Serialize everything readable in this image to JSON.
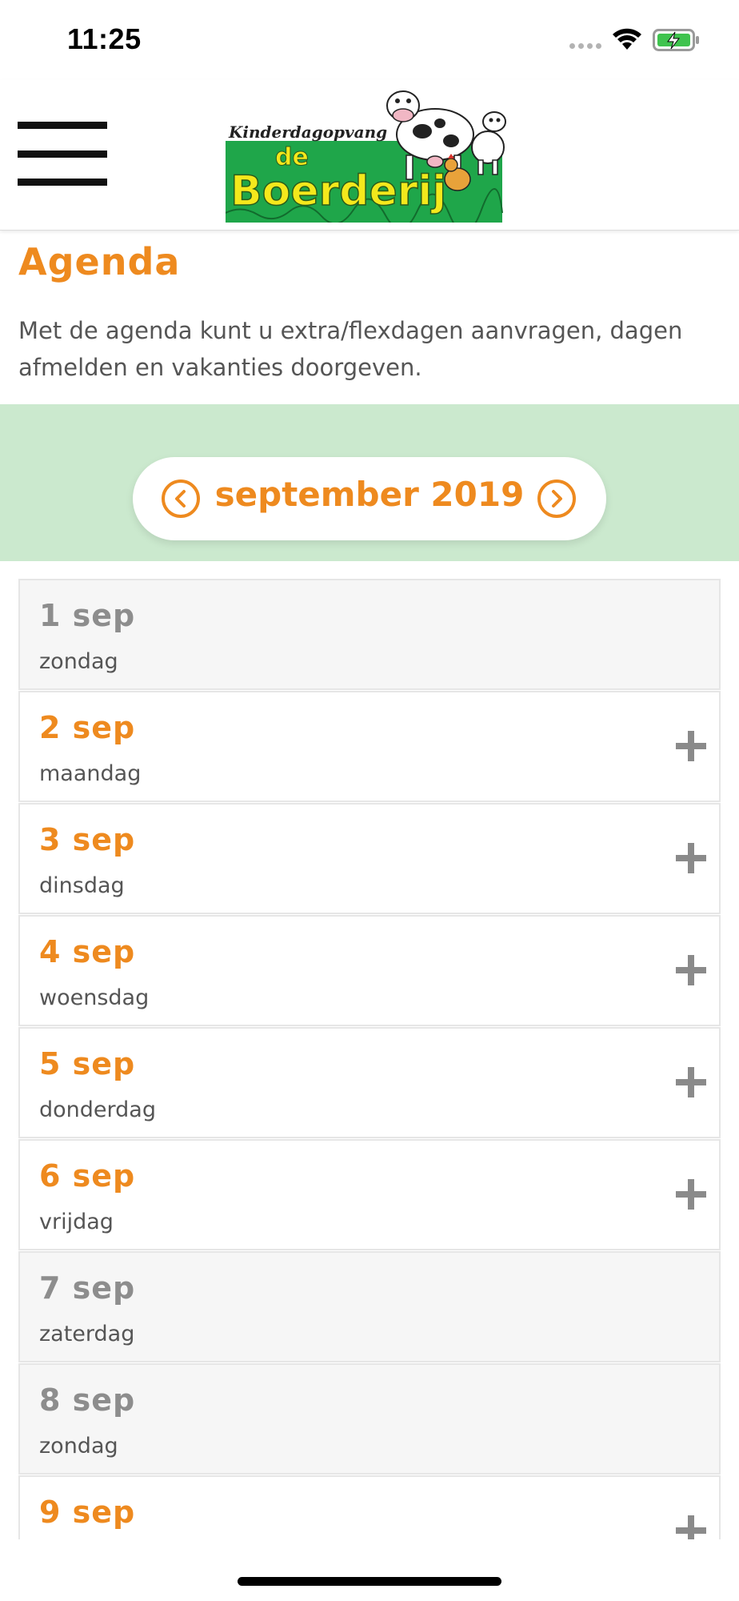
{
  "status_bar": {
    "time": "11:25"
  },
  "header": {
    "logo": {
      "line1": "Kinderdagopvang",
      "line2": "de",
      "line3": "Boerderij"
    }
  },
  "page": {
    "title": "Agenda",
    "intro": "Met de agenda kunt u extra/flexdagen aanvragen, dagen afmelden en vakanties doorgeven."
  },
  "month": {
    "label": "september 2019"
  },
  "days": [
    {
      "date": "1 sep",
      "weekday": "zondag",
      "weekend": true,
      "addable": false
    },
    {
      "date": "2 sep",
      "weekday": "maandag",
      "weekend": false,
      "addable": true
    },
    {
      "date": "3 sep",
      "weekday": "dinsdag",
      "weekend": false,
      "addable": true
    },
    {
      "date": "4 sep",
      "weekday": "woensdag",
      "weekend": false,
      "addable": true
    },
    {
      "date": "5 sep",
      "weekday": "donderdag",
      "weekend": false,
      "addable": true
    },
    {
      "date": "6 sep",
      "weekday": "vrijdag",
      "weekend": false,
      "addable": true
    },
    {
      "date": "7 sep",
      "weekday": "zaterdag",
      "weekend": true,
      "addable": false
    },
    {
      "date": "8 sep",
      "weekday": "zondag",
      "weekend": true,
      "addable": false
    },
    {
      "date": "9 sep",
      "weekday": "",
      "weekend": false,
      "addable": true
    }
  ],
  "colors": {
    "accent": "#ee8a1f",
    "band": "#cbe9ce",
    "weekend_row": "#f6f6f6",
    "logo_green": "#1fa64a",
    "logo_yellow": "#f4e81c"
  }
}
